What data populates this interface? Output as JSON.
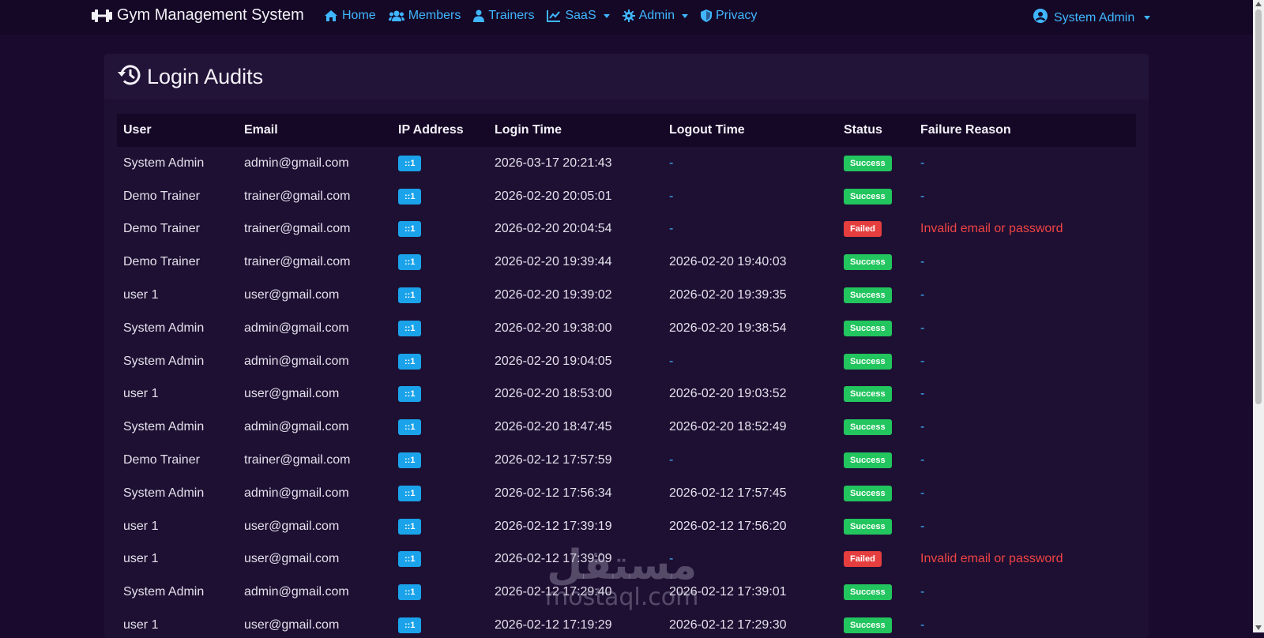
{
  "brand": {
    "name": "Gym Management System",
    "icon": "dumbbell-icon"
  },
  "nav": [
    {
      "label": "Home",
      "icon": "home-icon",
      "dropdown": false
    },
    {
      "label": "Members",
      "icon": "users-icon",
      "dropdown": false
    },
    {
      "label": "Trainers",
      "icon": "user-icon",
      "dropdown": false
    },
    {
      "label": "SaaS",
      "icon": "chart-line-icon",
      "dropdown": true
    },
    {
      "label": "Admin",
      "icon": "gear-icon",
      "dropdown": true
    },
    {
      "label": "Privacy",
      "icon": "shield-icon",
      "dropdown": false
    }
  ],
  "user_menu": {
    "label": "System Admin",
    "icon": "user-circle-icon"
  },
  "page": {
    "title": "Login Audits",
    "icon": "history-icon"
  },
  "table": {
    "columns": [
      "User",
      "Email",
      "IP Address",
      "Login Time",
      "Logout Time",
      "Status",
      "Failure Reason"
    ],
    "rows": [
      {
        "user": "System Admin",
        "email": "admin@gmail.com",
        "ip": "::1",
        "login": "2026-03-17 20:21:43",
        "logout": "-",
        "status": "Success",
        "reason": "-"
      },
      {
        "user": "Demo Trainer",
        "email": "trainer@gmail.com",
        "ip": "::1",
        "login": "2026-02-20 20:05:01",
        "logout": "-",
        "status": "Success",
        "reason": "-"
      },
      {
        "user": "Demo Trainer",
        "email": "trainer@gmail.com",
        "ip": "::1",
        "login": "2026-02-20 20:04:54",
        "logout": "-",
        "status": "Failed",
        "reason": "Invalid email or password"
      },
      {
        "user": "Demo Trainer",
        "email": "trainer@gmail.com",
        "ip": "::1",
        "login": "2026-02-20 19:39:44",
        "logout": "2026-02-20 19:40:03",
        "status": "Success",
        "reason": "-"
      },
      {
        "user": "user 1",
        "email": "user@gmail.com",
        "ip": "::1",
        "login": "2026-02-20 19:39:02",
        "logout": "2026-02-20 19:39:35",
        "status": "Success",
        "reason": "-"
      },
      {
        "user": "System Admin",
        "email": "admin@gmail.com",
        "ip": "::1",
        "login": "2026-02-20 19:38:00",
        "logout": "2026-02-20 19:38:54",
        "status": "Success",
        "reason": "-"
      },
      {
        "user": "System Admin",
        "email": "admin@gmail.com",
        "ip": "::1",
        "login": "2026-02-20 19:04:05",
        "logout": "-",
        "status": "Success",
        "reason": "-"
      },
      {
        "user": "user 1",
        "email": "user@gmail.com",
        "ip": "::1",
        "login": "2026-02-20 18:53:00",
        "logout": "2026-02-20 19:03:52",
        "status": "Success",
        "reason": "-"
      },
      {
        "user": "System Admin",
        "email": "admin@gmail.com",
        "ip": "::1",
        "login": "2026-02-20 18:47:45",
        "logout": "2026-02-20 18:52:49",
        "status": "Success",
        "reason": "-"
      },
      {
        "user": "Demo Trainer",
        "email": "trainer@gmail.com",
        "ip": "::1",
        "login": "2026-02-12 17:57:59",
        "logout": "-",
        "status": "Success",
        "reason": "-"
      },
      {
        "user": "System Admin",
        "email": "admin@gmail.com",
        "ip": "::1",
        "login": "2026-02-12 17:56:34",
        "logout": "2026-02-12 17:57:45",
        "status": "Success",
        "reason": "-"
      },
      {
        "user": "user 1",
        "email": "user@gmail.com",
        "ip": "::1",
        "login": "2026-02-12 17:39:19",
        "logout": "2026-02-12 17:56:20",
        "status": "Success",
        "reason": "-"
      },
      {
        "user": "user 1",
        "email": "user@gmail.com",
        "ip": "::1",
        "login": "2026-02-12 17:39:09",
        "logout": "-",
        "status": "Failed",
        "reason": "Invalid email or password"
      },
      {
        "user": "System Admin",
        "email": "admin@gmail.com",
        "ip": "::1",
        "login": "2026-02-12 17:29:40",
        "logout": "2026-02-12 17:39:01",
        "status": "Success",
        "reason": "-"
      },
      {
        "user": "user 1",
        "email": "user@gmail.com",
        "ip": "::1",
        "login": "2026-02-12 17:19:29",
        "logout": "2026-02-12 17:29:30",
        "status": "Success",
        "reason": "-"
      }
    ]
  },
  "watermark": {
    "arabic": "مستقل",
    "latin": "mostaql.com"
  },
  "colors": {
    "background": "#1a0b2e",
    "navbar": "#150826",
    "link": "#3fb6ff",
    "success": "#22c55e",
    "failed": "#e53e3e",
    "ip_badge": "#1aa3ea"
  }
}
